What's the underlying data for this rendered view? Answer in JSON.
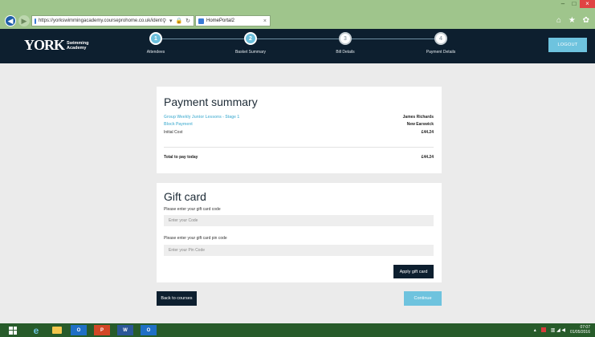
{
  "browser": {
    "url": "https://yorkswimmingacademy.courseprohome.co.uk/ident",
    "tab_title": "HomePortal2",
    "tab_close": "×",
    "win_minimize": "–",
    "win_maximize": "□",
    "win_close": "×",
    "right_icons": "⌂ ★ ✿"
  },
  "header": {
    "logo_mark": "YORK",
    "logo_sub_1": "Swimming",
    "logo_sub_2": "Academy",
    "logout_label": "LOGOUT",
    "steps": [
      {
        "number": "1",
        "label": "Attendees",
        "state": "done"
      },
      {
        "number": "2",
        "label": "Basket Summary",
        "state": "done"
      },
      {
        "number": "3",
        "label": "Bill Details",
        "state": "todo"
      },
      {
        "number": "4",
        "label": "Payment Details",
        "state": "todo"
      }
    ]
  },
  "summary": {
    "title": "Payment summary",
    "course_name": "Group Weekly Junior Lessons - Stage 1",
    "payment_type": "Block Payment",
    "attendee_name": "James Richards",
    "venue": "New Earswick",
    "initial_cost_label": "Initial Cost",
    "initial_cost_value": "£44.24",
    "total_label": "Total to pay today",
    "total_value": "£44.24"
  },
  "gift_card": {
    "title": "Gift card",
    "code_label": "Please enter your gift card code",
    "code_placeholder": "Enter your Code",
    "pin_label": "Please enter your gift card pin code",
    "pin_placeholder": "Enter your Pin Code",
    "apply_label": "Apply gift card"
  },
  "actions": {
    "back_label": "Back to courses",
    "continue_label": "Continue"
  },
  "taskbar": {
    "outlook_label": "O",
    "ppt_label": "P",
    "word_label": "W",
    "outlook2_label": "O",
    "time": "07:07",
    "date": "01/05/2016"
  },
  "colors": {
    "header_bg": "#0d1f2f",
    "accent": "#6ec3de",
    "page_bg": "#ebebeb",
    "browser_chrome": "#9fc58c",
    "taskbar": "#275b2a"
  }
}
